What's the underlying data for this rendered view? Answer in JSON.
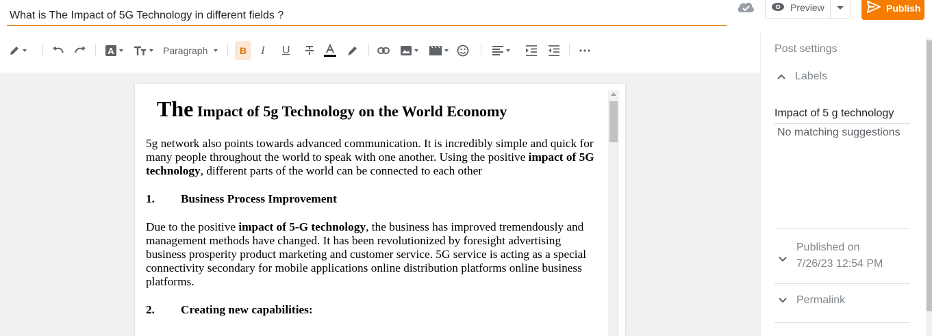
{
  "header": {
    "title_value": "What is The Impact of 5G Technology in different fields ?",
    "preview_label": "Preview",
    "publish_label": "Publish"
  },
  "toolbar": {
    "paragraph_label": "Paragraph",
    "bold_label": "B",
    "italic_label": "I",
    "underline_label": "U"
  },
  "document": {
    "title_first": "The",
    "title_rest": " Impact of 5g Technology on the World Economy",
    "intro_pre": "5g  network also points towards advanced communication.  It is incredibly simple and quick for many people throughout the world to speak with one another. Using the positive ",
    "intro_bold": "impact of 5G technology",
    "intro_post": ", different parts of the world can be connected to each other",
    "h1_num": "1.",
    "h1_text": "Business Process Improvement",
    "p2_pre": "Due to the positive ",
    "p2_bold": "impact of 5-G technology",
    "p2_post": ", the business has improved tremendously and management methods have changed. It has been revolutionized by foresight advertising business prosperity product marketing and customer service. 5G service is acting as a special connectivity secondary for mobile applications online distribution platforms online business platforms.",
    "h2_num": "2.",
    "h2_text": "Creating new capabilities:"
  },
  "side_panel": {
    "heading": "Post settings",
    "labels_label": "Labels",
    "labels_value": "Impact of 5 g technology",
    "no_match": "No matching suggestions",
    "published_label": "Published on",
    "published_date": "7/26/23 12:54 PM",
    "permalink_label": "Permalink"
  },
  "colors": {
    "accent": "#f57c00",
    "title_underline": "#e37400"
  }
}
